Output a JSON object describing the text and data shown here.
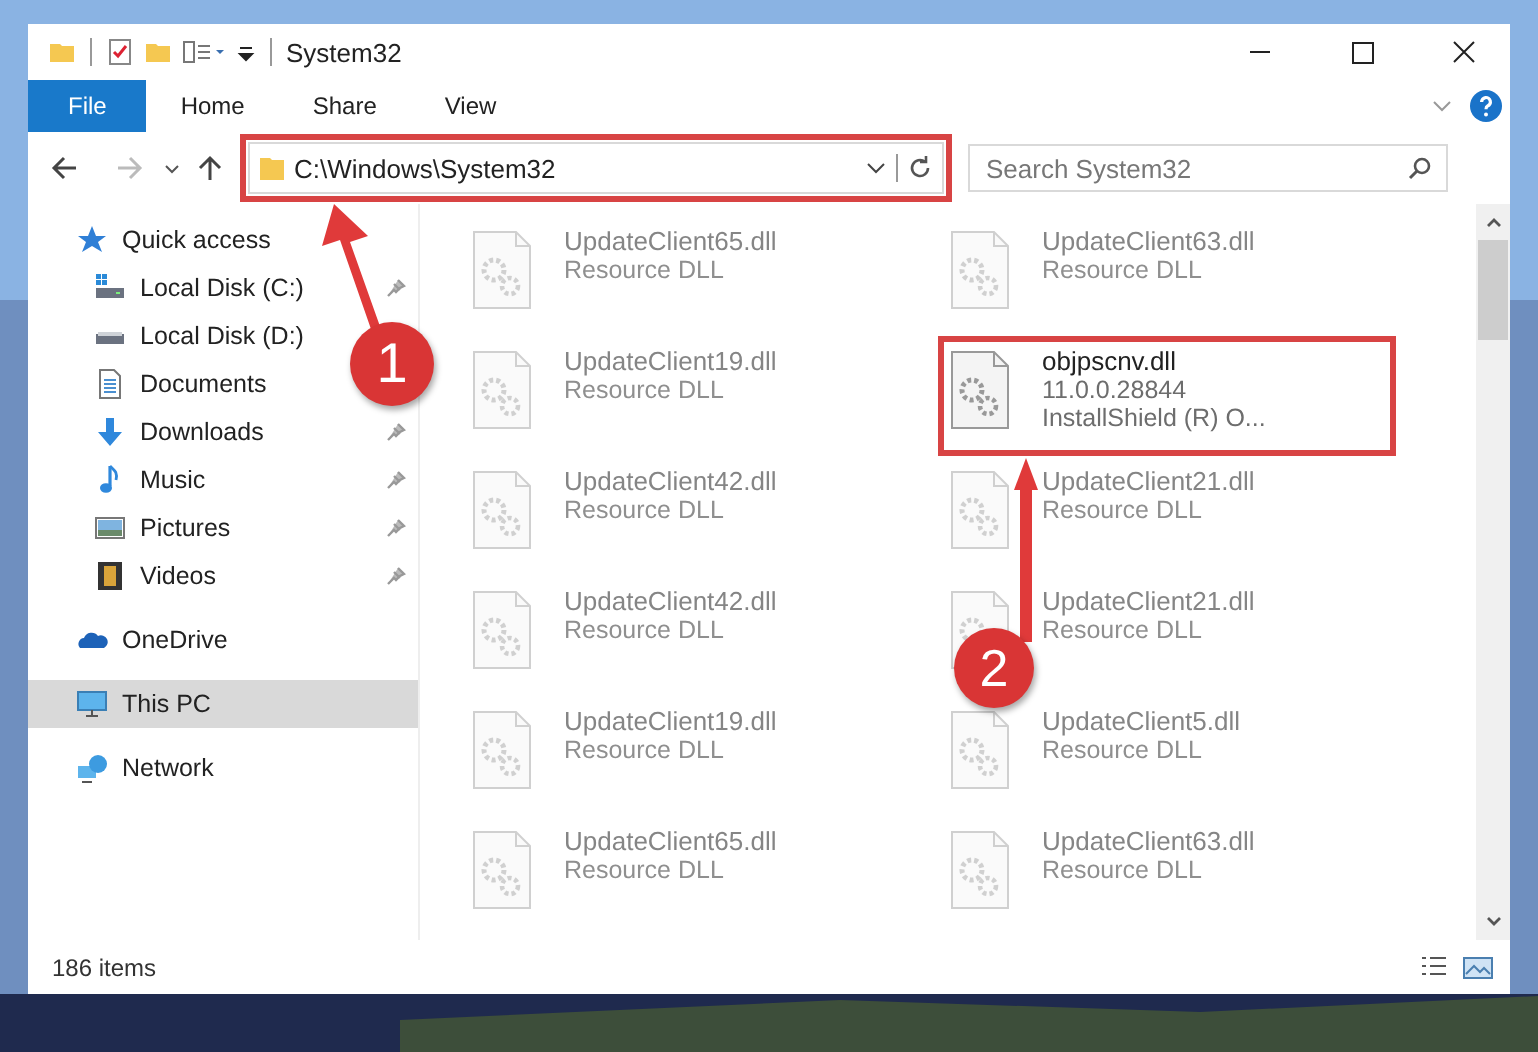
{
  "window": {
    "title": "System32"
  },
  "ribbon_tabs": [
    {
      "label": "File",
      "selected": true
    },
    {
      "label": "Home",
      "selected": false
    },
    {
      "label": "Share",
      "selected": false
    },
    {
      "label": "View",
      "selected": false
    }
  ],
  "address": {
    "value": "C:\\Windows\\System32",
    "highlighted": true
  },
  "search": {
    "placeholder": "Search System32"
  },
  "sidebar": {
    "items": [
      {
        "label": "Quick access",
        "kind": "star",
        "selected": false,
        "children": [
          {
            "label": "Local Disk (C:)",
            "kind": "drive-c",
            "pinned": true,
            "selected": false
          },
          {
            "label": "Local Disk (D:)",
            "kind": "drive",
            "pinned": false,
            "selected": false
          },
          {
            "label": "Documents",
            "kind": "documents",
            "pinned": false,
            "selected": false
          },
          {
            "label": "Downloads",
            "kind": "downloads",
            "pinned": true,
            "selected": false
          },
          {
            "label": "Music",
            "kind": "music",
            "pinned": true,
            "selected": false
          },
          {
            "label": "Pictures",
            "kind": "pictures",
            "pinned": true,
            "selected": false
          },
          {
            "label": "Videos",
            "kind": "videos",
            "pinned": true,
            "selected": false
          }
        ]
      },
      {
        "label": "OneDrive",
        "kind": "cloud",
        "selected": false
      },
      {
        "label": "This PC",
        "kind": "pc",
        "selected": true
      },
      {
        "label": "Network",
        "kind": "network",
        "selected": false
      }
    ]
  },
  "files": [
    {
      "name": "UpdateClient65.dll",
      "lines": [
        "Resource DLL"
      ],
      "faded": true,
      "highlighted": false
    },
    {
      "name": "UpdateClient63.dll",
      "lines": [
        "Resource DLL"
      ],
      "faded": true,
      "highlighted": false
    },
    {
      "name": "UpdateClient19.dll",
      "lines": [
        "Resource DLL"
      ],
      "faded": true,
      "highlighted": false
    },
    {
      "name": "objpscnv.dll",
      "lines": [
        "11.0.0.28844",
        "InstallShield (R) O..."
      ],
      "faded": false,
      "highlighted": true
    },
    {
      "name": "UpdateClient42.dll",
      "lines": [
        "Resource DLL"
      ],
      "faded": true,
      "highlighted": false
    },
    {
      "name": "UpdateClient21.dll",
      "lines": [
        "Resource DLL"
      ],
      "faded": true,
      "highlighted": false
    },
    {
      "name": "UpdateClient42.dll",
      "lines": [
        "Resource DLL"
      ],
      "faded": true,
      "highlighted": false
    },
    {
      "name": "UpdateClient21.dll",
      "lines": [
        "Resource DLL"
      ],
      "faded": true,
      "highlighted": false
    },
    {
      "name": "UpdateClient19.dll",
      "lines": [
        "Resource DLL"
      ],
      "faded": true,
      "highlighted": false
    },
    {
      "name": "UpdateClient5.dll",
      "lines": [
        "Resource DLL"
      ],
      "faded": true,
      "highlighted": false
    },
    {
      "name": "UpdateClient65.dll",
      "lines": [
        "Resource DLL"
      ],
      "faded": true,
      "highlighted": false
    },
    {
      "name": "UpdateClient63.dll",
      "lines": [
        "Resource DLL"
      ],
      "faded": true,
      "highlighted": false
    }
  ],
  "status_bar": {
    "count": "186 items"
  },
  "annotations": [
    {
      "number": "1"
    },
    {
      "number": "2"
    }
  ]
}
